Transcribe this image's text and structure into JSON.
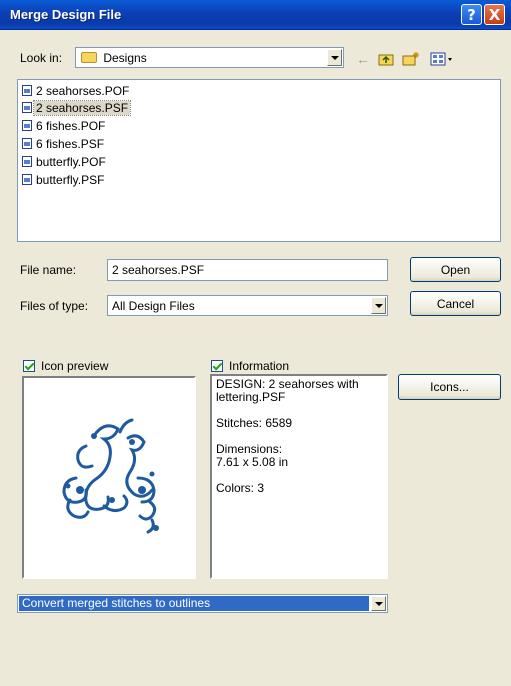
{
  "window": {
    "title": "Merge Design File"
  },
  "titlebar_buttons": {
    "help": "?",
    "close": "X"
  },
  "lookin": {
    "label": "Look in:",
    "value": "Designs"
  },
  "files": [
    {
      "name": "2 seahorses.POF",
      "selected": false
    },
    {
      "name": "2 seahorses.PSF",
      "selected": true
    },
    {
      "name": "6 fishes.POF",
      "selected": false
    },
    {
      "name": "6 fishes.PSF",
      "selected": false
    },
    {
      "name": "butterfly.POF",
      "selected": false
    },
    {
      "name": "butterfly.PSF",
      "selected": false
    }
  ],
  "file_name": {
    "label": "File name:",
    "value": "2 seahorses.PSF"
  },
  "file_type": {
    "label": "Files of type:",
    "value": "All Design Files"
  },
  "buttons": {
    "open": "Open",
    "cancel": "Cancel",
    "icons": "Icons..."
  },
  "icon_preview": {
    "label": "Icon preview",
    "checked": true
  },
  "information": {
    "label": "Information",
    "checked": true,
    "design": "DESIGN:  2 seahorses with lettering.PSF",
    "stitches": "Stitches:  6589",
    "dimensions_label": "Dimensions:",
    "dimensions_value": "7.61 x 5.08 in",
    "colors": "Colors:  3"
  },
  "convert": {
    "value": "Convert merged stitches to outlines"
  },
  "colors": {
    "titlebar": "#0c3fb6",
    "selection": "#316ac5",
    "preview_stitch": "#1f5a9e"
  }
}
